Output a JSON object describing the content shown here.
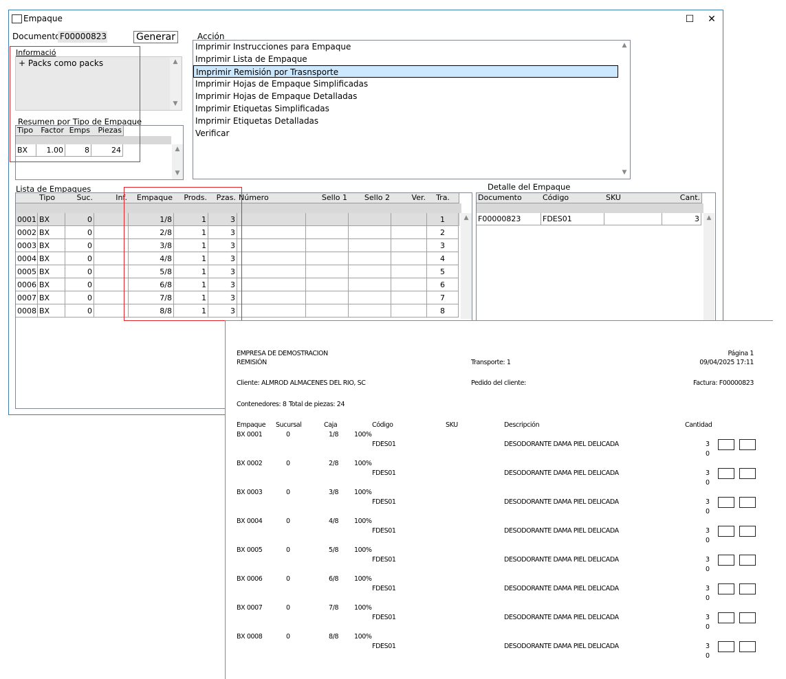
{
  "window": {
    "title": "Empaque",
    "maximize_glyph": "☐",
    "close_glyph": "✕"
  },
  "documento": {
    "label": "Documento:",
    "value": "F00000823"
  },
  "generar_label": "Generar",
  "informacion": {
    "label": "Informació",
    "lines": [
      "+ Packs como packs"
    ]
  },
  "resumen": {
    "label": "Resumen por Tipo de Empaque",
    "headers": [
      "Tipo",
      "Factor",
      "Emps",
      "Piezas"
    ],
    "rows": [
      [
        "BX",
        "1.00",
        "8",
        "24"
      ]
    ]
  },
  "accion": {
    "label": "Acción",
    "items": [
      "Imprimir Instrucciones para Empaque",
      "Imprimir Lista de Empaque",
      "Imprimir Remisión por Trasnsporte",
      "Imprimir Hojas de Empaque Simplificadas",
      "Imprimir Hojas de Empaque Detalladas",
      "Imprimir Etiquetas Simplificadas",
      "Imprimir Etiquetas Detalladas",
      "Verificar"
    ],
    "selected_index": 2
  },
  "lista": {
    "label": "Lista de Empaques",
    "headers": [
      "",
      "Tipo",
      "Suc.",
      "Inf.",
      "Empaque",
      "Prods.",
      "Pzas.",
      "Número",
      "Sello 1",
      "Sello 2",
      "Ver.",
      "Tra."
    ],
    "rows": [
      [
        "0001",
        "BX",
        "0",
        "",
        "1/8",
        "1",
        "3",
        "",
        "",
        "",
        "",
        "1"
      ],
      [
        "0002",
        "BX",
        "0",
        "",
        "2/8",
        "1",
        "3",
        "",
        "",
        "",
        "",
        "2"
      ],
      [
        "0003",
        "BX",
        "0",
        "",
        "3/8",
        "1",
        "3",
        "",
        "",
        "",
        "",
        "3"
      ],
      [
        "0004",
        "BX",
        "0",
        "",
        "4/8",
        "1",
        "3",
        "",
        "",
        "",
        "",
        "4"
      ],
      [
        "0005",
        "BX",
        "0",
        "",
        "5/8",
        "1",
        "3",
        "",
        "",
        "",
        "",
        "5"
      ],
      [
        "0006",
        "BX",
        "0",
        "",
        "6/8",
        "1",
        "3",
        "",
        "",
        "",
        "",
        "6"
      ],
      [
        "0007",
        "BX",
        "0",
        "",
        "7/8",
        "1",
        "3",
        "",
        "",
        "",
        "",
        "7"
      ],
      [
        "0008",
        "BX",
        "0",
        "",
        "8/8",
        "1",
        "3",
        "",
        "",
        "",
        "",
        "8"
      ]
    ]
  },
  "detalle": {
    "label": "Detalle del Empaque",
    "headers": [
      "Documento",
      "Código",
      "SKU",
      "Cant."
    ],
    "rows": [
      [
        "F00000823",
        "FDES01",
        "",
        "3"
      ]
    ]
  },
  "report": {
    "company": "EMPRESA DE DEMOSTRACION",
    "doc_type": "REMISIÓN",
    "transport": "Transporte: 1",
    "page": "Página 1",
    "datetime": "09/04/2025  17:11",
    "client": "Cliente: ALMROD  ALMACENES DEL RIO, SC",
    "pedido": "Pedido del cliente:",
    "factura": "Factura: F00000823",
    "contenedores": "Contenedores: 8",
    "total_piezas": "Total de piezas: 24",
    "headers": {
      "empaque": "Empaque",
      "sucursal": "Sucursal",
      "caja": "Caja",
      "codigo": "Código",
      "sku": "SKU",
      "descripcion": "Descripción",
      "cantidad": "Cantidad"
    },
    "rows": [
      {
        "empaque": "BX  0001",
        "sucursal": "0",
        "caja": "1/8",
        "pct": "100%",
        "codigo": "FDES01",
        "descripcion": "DESODORANTE DAMA PIEL DELICADA",
        "cantidad": "3",
        "sub": "0"
      },
      {
        "empaque": "BX  0002",
        "sucursal": "0",
        "caja": "2/8",
        "pct": "100%",
        "codigo": "FDES01",
        "descripcion": "DESODORANTE DAMA PIEL DELICADA",
        "cantidad": "3",
        "sub": "0"
      },
      {
        "empaque": "BX  0003",
        "sucursal": "0",
        "caja": "3/8",
        "pct": "100%",
        "codigo": "FDES01",
        "descripcion": "DESODORANTE DAMA PIEL DELICADA",
        "cantidad": "3",
        "sub": "0"
      },
      {
        "empaque": "BX  0004",
        "sucursal": "0",
        "caja": "4/8",
        "pct": "100%",
        "codigo": "FDES01",
        "descripcion": "DESODORANTE DAMA PIEL DELICADA",
        "cantidad": "3",
        "sub": "0"
      },
      {
        "empaque": "BX  0005",
        "sucursal": "0",
        "caja": "5/8",
        "pct": "100%",
        "codigo": "FDES01",
        "descripcion": "DESODORANTE DAMA PIEL DELICADA",
        "cantidad": "3",
        "sub": "0"
      },
      {
        "empaque": "BX  0006",
        "sucursal": "0",
        "caja": "6/8",
        "pct": "100%",
        "codigo": "FDES01",
        "descripcion": "DESODORANTE DAMA PIEL DELICADA",
        "cantidad": "3",
        "sub": "0"
      },
      {
        "empaque": "BX  0007",
        "sucursal": "0",
        "caja": "7/8",
        "pct": "100%",
        "codigo": "FDES01",
        "descripcion": "DESODORANTE DAMA PIEL DELICADA",
        "cantidad": "3",
        "sub": "0"
      },
      {
        "empaque": "BX  0008",
        "sucursal": "0",
        "caja": "8/8",
        "pct": "100%",
        "codigo": "FDES01",
        "descripcion": "DESODORANTE DAMA PIEL DELICADA",
        "cantidad": "3",
        "sub": "0"
      }
    ]
  }
}
